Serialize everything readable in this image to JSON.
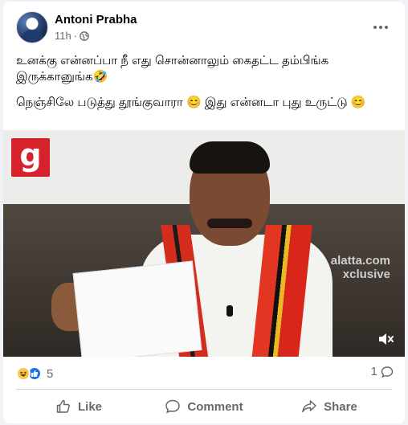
{
  "post": {
    "author": "Antoni Prabha",
    "time": "11h",
    "dot": "·",
    "text_line_1": "உனக்கு என்னப்பா நீ எது சொன்னாலும் கைதட்ட தம்பிங்க இருக்கானுங்க🤣",
    "text_line_2": "நெஞ்சிலே படுத்து தூங்குவாரா 😊 இது என்னடா புது உருட்டு 😊"
  },
  "video": {
    "channel_logo": "g",
    "watermark_line_1": "alatta.com",
    "watermark_line_2": "xclusive"
  },
  "stats": {
    "reaction_count": "5",
    "comment_count": "1"
  },
  "actions": {
    "like": "Like",
    "comment": "Comment",
    "share": "Share"
  },
  "icons": {
    "privacy": "globe-icon",
    "more": "more-icon",
    "mute": "mute-icon"
  },
  "colors": {
    "accent": "#1b74e4",
    "logo": "#d6222a",
    "muted_text": "#65676b"
  }
}
